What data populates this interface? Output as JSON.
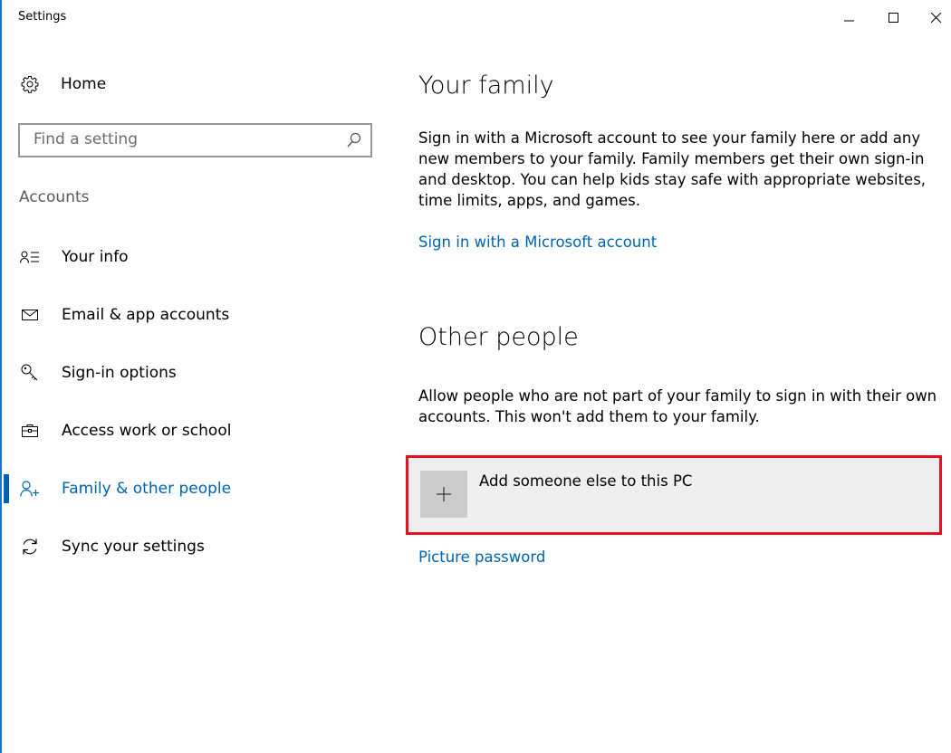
{
  "window": {
    "title": "Settings"
  },
  "sidebar": {
    "home_label": "Home",
    "search_placeholder": "Find a setting",
    "section_header": "Accounts",
    "items": [
      {
        "label": "Your info",
        "icon": "person-list-icon"
      },
      {
        "label": "Email & app accounts",
        "icon": "mail-icon"
      },
      {
        "label": "Sign-in options",
        "icon": "key-icon"
      },
      {
        "label": "Access work or school",
        "icon": "briefcase-icon"
      },
      {
        "label": "Family & other people",
        "icon": "person-add-icon",
        "selected": true
      },
      {
        "label": "Sync your settings",
        "icon": "sync-icon"
      }
    ]
  },
  "main": {
    "family": {
      "heading": "Your family",
      "description": "Sign in with a Microsoft account to see your family here or add any new members to your family. Family members get their own sign-in and desktop. You can help kids stay safe with appropriate websites, time limits, apps, and games.",
      "link": "Sign in with a Microsoft account"
    },
    "other": {
      "heading": "Other people",
      "description": "Allow people who are not part of your family to sign in with their own accounts. This won't add them to your family.",
      "add_label": "Add someone else to this PC"
    },
    "picture_password_link": "Picture password"
  },
  "colors": {
    "accent": "#0063b1",
    "highlight": "#e81123",
    "tile": "#efefef"
  }
}
